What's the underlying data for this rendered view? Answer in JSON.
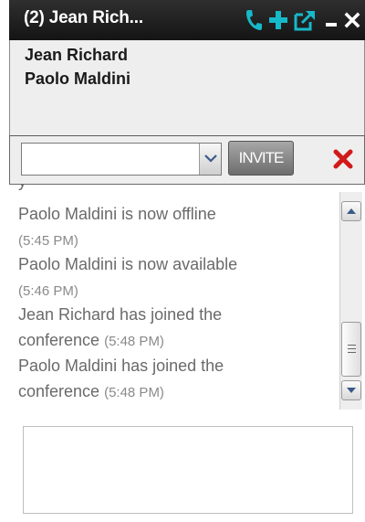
{
  "window": {
    "title": "(2) Jean Rich...",
    "accent_color": "#16b9c9",
    "titlebar_color": "#1c1c1c",
    "icons": [
      "phone-icon",
      "add-participant-icon",
      "popout-icon",
      "minimize-icon",
      "close-icon"
    ]
  },
  "participants": [
    {
      "name": "Jean Richard"
    },
    {
      "name": "Paolo Maldini"
    }
  ],
  "invite": {
    "combo_value": "",
    "button_label": "INVITE",
    "cancel_icon": "red-x-icon"
  },
  "chat": {
    "messages": [
      {
        "text": "Paolo Maldini is now offline",
        "time": "(5:45 PM)"
      },
      {
        "text": "Paolo Maldini is now available",
        "time": "(5:46 PM)"
      },
      {
        "text": "Jean Richard has joined the",
        "text2": "conference",
        "time": "(5:48 PM)"
      },
      {
        "text": "Paolo Maldini has joined the",
        "text2": "conference",
        "time": "(5:48 PM)"
      }
    ]
  },
  "compose": {
    "value": ""
  }
}
